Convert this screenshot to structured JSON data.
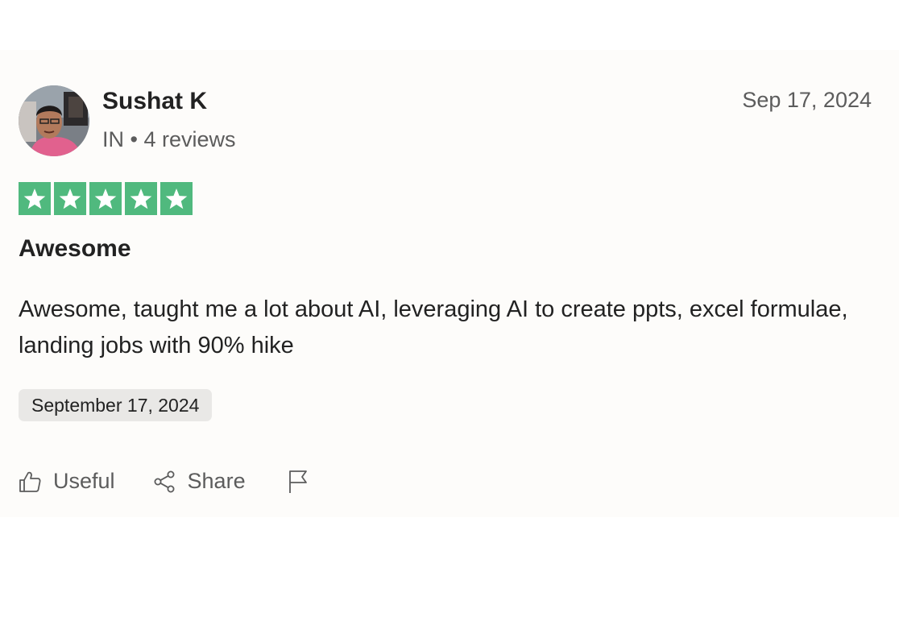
{
  "review": {
    "reviewer": {
      "name": "Sushat K",
      "country": "IN",
      "separator": "•",
      "review_count": "4 reviews",
      "avatar": "avatar-photo"
    },
    "date_short": "Sep 17, 2024",
    "rating": {
      "value": 5,
      "max": 5,
      "color": "#50b97e"
    },
    "title": "Awesome",
    "body": "Awesome, taught me a lot about AI, leveraging AI to create ppts, excel formulae, landing jobs with 90% hike",
    "date_experience": "September 17, 2024"
  },
  "actions": {
    "useful": {
      "label": "Useful",
      "icon": "thumbs-up-icon"
    },
    "share": {
      "label": "Share",
      "icon": "share-icon"
    },
    "report": {
      "icon": "flag-icon"
    }
  }
}
